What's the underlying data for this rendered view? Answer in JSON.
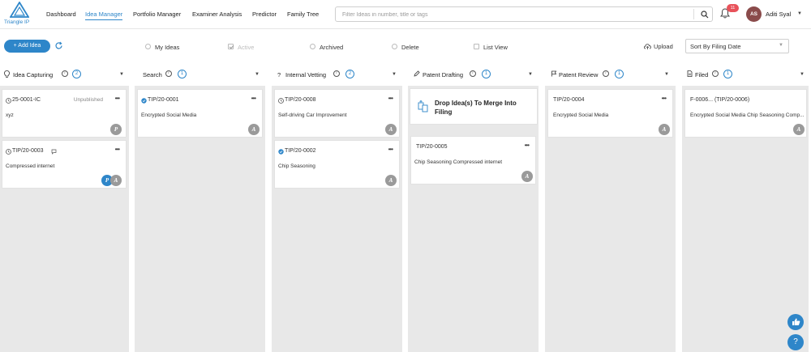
{
  "brand": {
    "logo_text": "Triangle IP"
  },
  "nav": {
    "items": [
      {
        "label": "Dashboard",
        "active": false
      },
      {
        "label": "Idea Manager",
        "active": true
      },
      {
        "label": "Portfolio Manager",
        "active": false
      },
      {
        "label": "Examiner Analysis",
        "active": false
      },
      {
        "label": "Predictor",
        "active": false
      },
      {
        "label": "Family Tree",
        "active": false
      }
    ]
  },
  "search": {
    "placeholder": "Filter Ideas in number, title or tags",
    "value": ""
  },
  "notifications": {
    "count": "11"
  },
  "user": {
    "initials": "AS",
    "name": "Aditi Syal"
  },
  "toolbar": {
    "add_label": "+ Add Idea",
    "filters": [
      {
        "label": "My Ideas",
        "type": "radio",
        "checked": false,
        "disabled": false
      },
      {
        "label": "Active",
        "type": "checkbox",
        "checked": true,
        "disabled": true
      },
      {
        "label": "Archived",
        "type": "radio",
        "checked": false,
        "disabled": false
      },
      {
        "label": "Delete",
        "type": "radio",
        "checked": false,
        "disabled": false
      },
      {
        "label": "List View",
        "type": "checkbox",
        "checked": false,
        "disabled": false
      }
    ],
    "upload_label": "Upload",
    "sort_value": "Sort By Filing Date"
  },
  "columns": [
    {
      "title": "Idea Capturing",
      "count": "2",
      "icon": "lightbulb-icon",
      "cards": [
        {
          "id": "25-0001-IC",
          "status": "Unpublished",
          "title": "xyz",
          "avatars": [
            "P"
          ],
          "icon": "clock-icon"
        },
        {
          "id": "TIP/20-0003",
          "status": "",
          "title": "Compressed internet",
          "avatars": [
            "P",
            "A"
          ],
          "icon": "clock-icon",
          "chat": true
        }
      ]
    },
    {
      "title": "Search",
      "count": "1",
      "icon": "",
      "cards": [
        {
          "id": "TIP/20-0001",
          "status": "",
          "title": "Encrypted Social Media",
          "avatars": [
            "A"
          ],
          "icon": "check-badge-icon"
        }
      ]
    },
    {
      "title": "Internal Vetting",
      "count": "2",
      "icon": "question-icon",
      "cards": [
        {
          "id": "TIP/20-0008",
          "status": "",
          "title": "Self-driving Car Improvement",
          "avatars": [
            "A"
          ],
          "icon": "clock-icon"
        },
        {
          "id": "TIP/20-0002",
          "status": "",
          "title": "Chip Seasoning",
          "avatars": [
            "A"
          ],
          "icon": "check-badge-icon"
        }
      ]
    },
    {
      "title": "Patent Drafting",
      "count": "1",
      "icon": "pencil-icon",
      "drop_text": "Drop Idea(s) To Merge Into Filing",
      "cards": [
        {
          "id": "TIP/20-0005",
          "status": "",
          "title": "Chip Seasoning Compressed internet",
          "avatars": [
            "A"
          ],
          "icon": ""
        }
      ]
    },
    {
      "title": "Patent Review",
      "count": "1",
      "icon": "flag-icon",
      "cards": [
        {
          "id": "TIP/20-0004",
          "status": "",
          "title": "Encrypted Social Media",
          "avatars": [
            "A"
          ],
          "icon": ""
        }
      ]
    },
    {
      "title": "Filed",
      "count": "1",
      "icon": "document-icon",
      "cards": [
        {
          "id": "F-0006... (TIP/20-0006)",
          "status": "",
          "title": "Encrypted Social Media Chip Seasoning Comp...",
          "avatars": [
            "A"
          ],
          "icon": ""
        }
      ]
    }
  ],
  "floating": {
    "thumbs_icon": "thumbs-up-icon",
    "help_label": "?"
  },
  "colors": {
    "accent": "#2e86c9",
    "badge": "#e8525a",
    "lane": "#e8e8e8",
    "avatar_user": "#8a4b4b"
  }
}
